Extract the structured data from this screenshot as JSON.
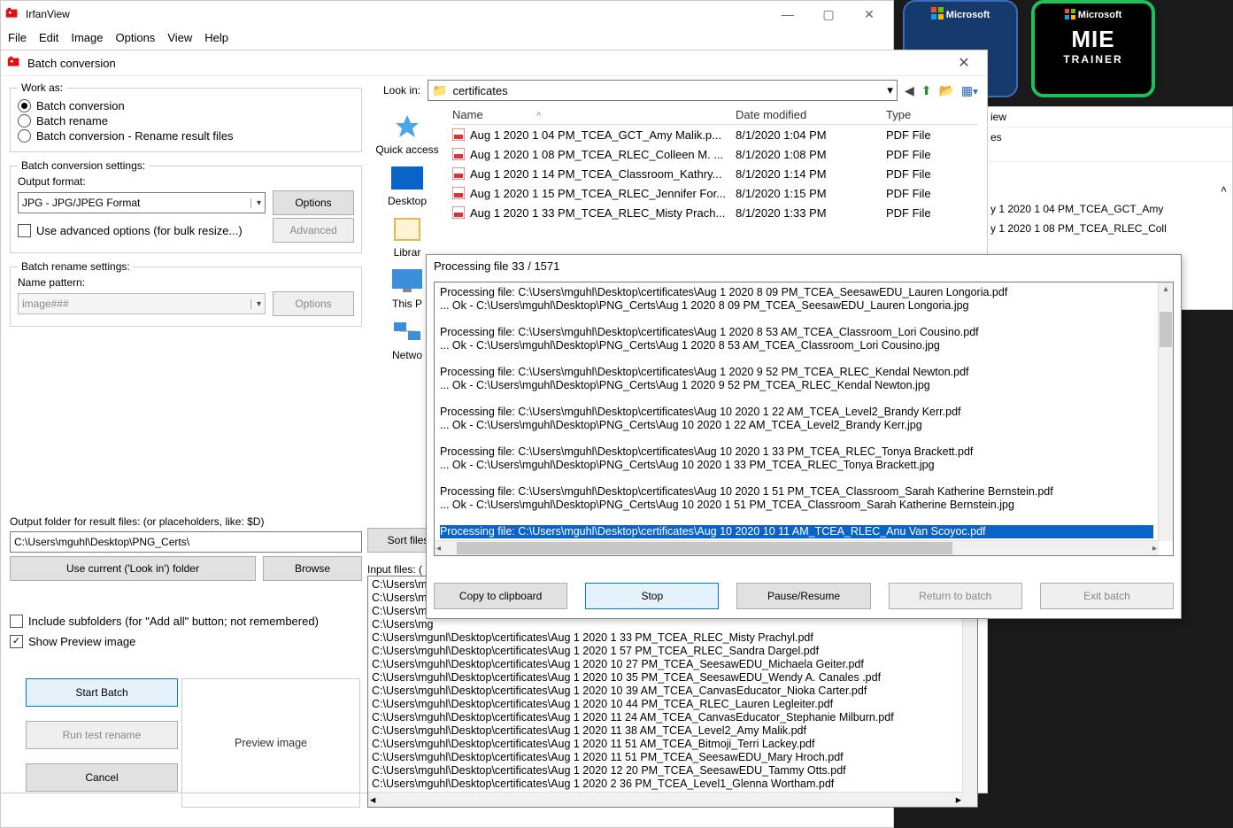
{
  "app": {
    "title": "IrfanView"
  },
  "menu": {
    "file": "File",
    "edit": "Edit",
    "image": "Image",
    "options": "Options",
    "view": "View",
    "help": "Help"
  },
  "batch": {
    "title": "Batch conversion",
    "work_as": "Work as:",
    "r1": "Batch conversion",
    "r2": "Batch rename",
    "r3": "Batch conversion - Rename result files",
    "conv_settings": "Batch conversion settings:",
    "out_fmt_lbl": "Output format:",
    "out_fmt": "JPG - JPG/JPEG Format",
    "options_btn": "Options",
    "adv_chk": "Use advanced options (for bulk resize...)",
    "advanced_btn": "Advanced",
    "ren_settings": "Batch rename settings:",
    "name_pattern_lbl": "Name pattern:",
    "name_pattern": "image###",
    "options2_btn": "Options",
    "out_folder_lbl": "Output folder for result files: (or placeholders, like: $D)",
    "out_folder": "C:\\Users\\mguhl\\Desktop\\PNG_Certs\\",
    "use_current": "Use current ('Look in') folder",
    "browse": "Browse",
    "inc_sub": "Include subfolders (for \"Add all\" button; not remembered)",
    "show_prev": "Show Preview image",
    "start": "Start Batch",
    "run_test": "Run test rename",
    "cancel": "Cancel",
    "preview": "Preview image",
    "lookin": "Look in:",
    "lookin_val": "certificates",
    "col_name": "Name",
    "col_date": "Date modified",
    "col_type": "Type",
    "files": [
      {
        "name": "Aug 1 2020 1 04 PM_TCEA_GCT_Amy Malik.p...",
        "date": "8/1/2020 1:04 PM",
        "type": "PDF File"
      },
      {
        "name": "Aug 1 2020 1 08 PM_TCEA_RLEC_Colleen M. ...",
        "date": "8/1/2020 1:08 PM",
        "type": "PDF File"
      },
      {
        "name": "Aug 1 2020 1 14 PM_TCEA_Classroom_Kathry...",
        "date": "8/1/2020 1:14 PM",
        "type": "PDF File"
      },
      {
        "name": "Aug 1 2020 1 15 PM_TCEA_RLEC_Jennifer For...",
        "date": "8/1/2020 1:15 PM",
        "type": "PDF File"
      },
      {
        "name": "Aug 1 2020 1 33 PM_TCEA_RLEC_Misty Prach...",
        "date": "8/1/2020 1:33 PM",
        "type": "PDF File"
      }
    ],
    "places": {
      "quick": "Quick access",
      "desktop": "Desktop",
      "libraries": "Librar",
      "thispc": "This P",
      "network": "Netwo"
    },
    "sort_files": "Sort files",
    "input_files_lbl": "Input files:  (",
    "input_files": [
      "C:\\Users\\mg",
      "C:\\Users\\mg",
      "C:\\Users\\mg",
      "C:\\Users\\mg",
      "C:\\Users\\mgunl\\Desktop\\certificates\\Aug 1 2020 1 33 PM_TCEA_RLEC_Misty Prachyl.pdf",
      "C:\\Users\\mguhl\\Desktop\\certificates\\Aug 1 2020 1 57 PM_TCEA_RLEC_Sandra Dargel.pdf",
      "C:\\Users\\mguhl\\Desktop\\certificates\\Aug 1 2020 10 27 PM_TCEA_SeesawEDU_Michaela Geiter.pdf",
      "C:\\Users\\mguhl\\Desktop\\certificates\\Aug 1 2020 10 35 PM_TCEA_SeesawEDU_Wendy A. Canales .pdf",
      "C:\\Users\\mguhl\\Desktop\\certificates\\Aug 1 2020 10 39 AM_TCEA_CanvasEducator_Nioka Carter.pdf",
      "C:\\Users\\mguhl\\Desktop\\certificates\\Aug 1 2020 10 44 PM_TCEA_RLEC_Lauren Legleiter.pdf",
      "C:\\Users\\mguhl\\Desktop\\certificates\\Aug 1 2020 11 24 AM_TCEA_CanvasEducator_Stephanie Milburn.pdf",
      "C:\\Users\\mguhl\\Desktop\\certificates\\Aug 1 2020 11 38 AM_TCEA_Level2_Amy Malik.pdf",
      "C:\\Users\\mguhl\\Desktop\\certificates\\Aug 1 2020 11 51 AM_TCEA_Bitmoji_Terri Lackey.pdf",
      "C:\\Users\\mguhl\\Desktop\\certificates\\Aug 1 2020 11 51 PM_TCEA_SeesawEDU_Mary Hroch.pdf",
      "C:\\Users\\mguhl\\Desktop\\certificates\\Aug 1 2020 12 20 PM_TCEA_SeesawEDU_Tammy Otts.pdf",
      "C:\\Users\\mguhl\\Desktop\\certificates\\Aug 1 2020 2 36 PM_TCEA_Level1_Glenna Wortham.pdf"
    ]
  },
  "progress": {
    "title": "Processing file 33 / 1571",
    "log_pairs": [
      [
        "Processing file: C:\\Users\\mguhl\\Desktop\\certificates\\Aug 1 2020 8 09 PM_TCEA_SeesawEDU_Lauren Longoria.pdf",
        "... Ok - C:\\Users\\mguhl\\Desktop\\PNG_Certs\\Aug 1 2020 8 09 PM_TCEA_SeesawEDU_Lauren Longoria.jpg"
      ],
      [
        "Processing file: C:\\Users\\mguhl\\Desktop\\certificates\\Aug 1 2020 8 53 AM_TCEA_Classroom_Lori Cousino.pdf",
        "... Ok - C:\\Users\\mguhl\\Desktop\\PNG_Certs\\Aug 1 2020 8 53 AM_TCEA_Classroom_Lori Cousino.jpg"
      ],
      [
        "Processing file: C:\\Users\\mguhl\\Desktop\\certificates\\Aug 1 2020 9 52 PM_TCEA_RLEC_Kendal Newton.pdf",
        "... Ok - C:\\Users\\mguhl\\Desktop\\PNG_Certs\\Aug 1 2020 9 52 PM_TCEA_RLEC_Kendal Newton.jpg"
      ],
      [
        "Processing file: C:\\Users\\mguhl\\Desktop\\certificates\\Aug 10 2020 1 22 AM_TCEA_Level2_Brandy Kerr.pdf",
        "... Ok - C:\\Users\\mguhl\\Desktop\\PNG_Certs\\Aug 10 2020 1 22 AM_TCEA_Level2_Brandy Kerr.jpg"
      ],
      [
        "Processing file: C:\\Users\\mguhl\\Desktop\\certificates\\Aug 10 2020 1 33 PM_TCEA_RLEC_Tonya Brackett.pdf",
        "... Ok - C:\\Users\\mguhl\\Desktop\\PNG_Certs\\Aug 10 2020 1 33 PM_TCEA_RLEC_Tonya Brackett.jpg"
      ],
      [
        "Processing file: C:\\Users\\mguhl\\Desktop\\certificates\\Aug 10 2020 1 51 PM_TCEA_Classroom_Sarah Katherine Bernstein.pdf",
        "... Ok - C:\\Users\\mguhl\\Desktop\\PNG_Certs\\Aug 10 2020 1 51 PM_TCEA_Classroom_Sarah Katherine Bernstein.jpg"
      ]
    ],
    "current": "Processing file: C:\\Users\\mguhl\\Desktop\\certificates\\Aug 10 2020 10 11 AM_TCEA_RLEC_Anu Van Scoyoc.pdf",
    "copy": "Copy to clipboard",
    "stop": "Stop",
    "pause": "Pause/Resume",
    "return": "Return to batch",
    "exit": "Exit batch"
  },
  "bg": {
    "ms": "Microsoft",
    "mie": "MIE",
    "trainer": "TRAINER",
    "iew": "iew",
    "es": "es",
    "row0": "y 1 2020 1 04 PM_TCEA_GCT_Amy",
    "row1": "y 1 2020 1 08 PM_TCEA_RLEC_Coll"
  }
}
